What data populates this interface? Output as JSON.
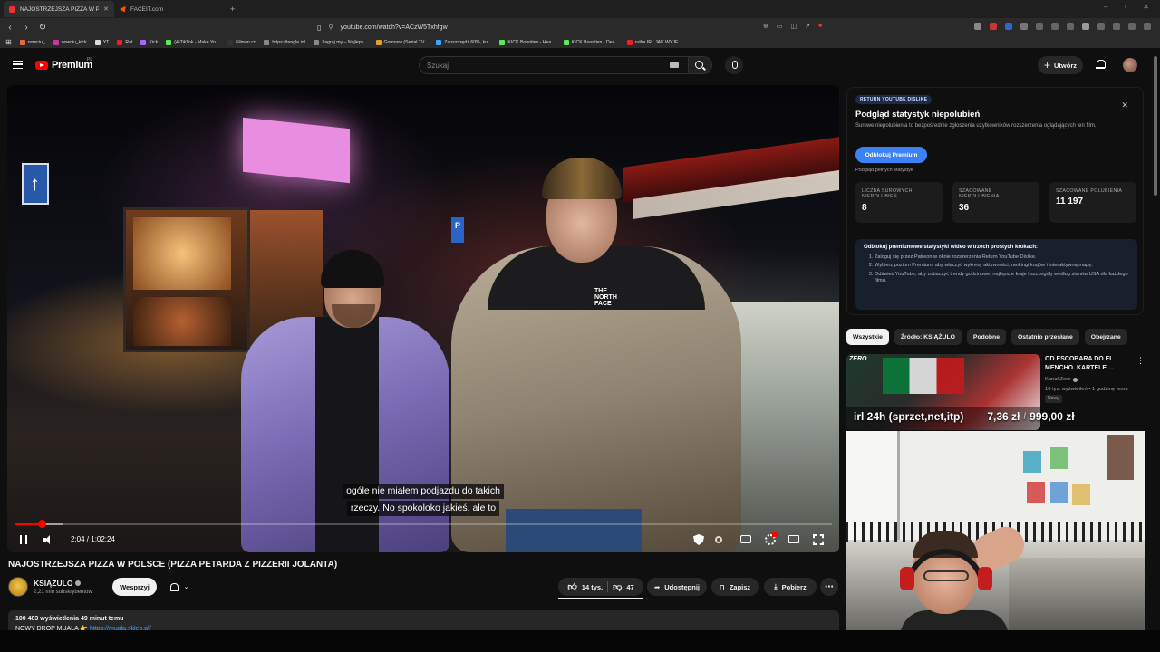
{
  "browser": {
    "tabs": [
      {
        "label": "NAJOSTRZEJSZA PIZZA W PO",
        "active": true
      },
      {
        "label": "FACEIT.com",
        "active": false
      }
    ],
    "url": "youtube.com/watch?v=ACzW5Txhfgw",
    "bookmarks": [
      "nowciu_",
      "nowciu_kick",
      "YT",
      "Rat",
      "Kick",
      "(4)TikTok - Make Yo...",
      "Filman.cc",
      "https://tangle.io/",
      "Zagraj.my – Najleps...",
      "Gomorra (Serial TV...",
      "Zaoszczędź 60%, ku...",
      "KICK Bounties - Hea...",
      "KICK Bounties - Dea...",
      "rutka IRL JAK WYJE..."
    ]
  },
  "header": {
    "logo_text": "Premium",
    "region": "PL",
    "search_placeholder": "Szukaj",
    "create_label": "Utwórz"
  },
  "player": {
    "caption_line1": "ogóle nie miałem podjazdu do takich",
    "caption_line2": "rzeczy. No spokoloko jakieś, ale to",
    "time": "2:04 / 1:02:24",
    "progress": 0.033
  },
  "video": {
    "title": "NAJOSTRZEJSZA PIZZA W POLSCE (PIZZA PETARDA Z PIZZERII JOLANTA)",
    "channel": "KSIĄŻULO",
    "subscribers": "2,21 mln subskrybentów",
    "join_label": "Wesprzyj",
    "likes": "14 tys.",
    "dislikes": "47",
    "share_label": "Udostępnij",
    "save_label": "Zapisz",
    "download_label": "Pobierz",
    "stats": "100 483 wyświetlenia  49 minut temu",
    "desc_prefix": "NOWY DROP MUALA 👉",
    "desc_link": "https://muala.sklep.pl/"
  },
  "dislike_panel": {
    "badge": "RETURN YOUTUBE DISLIKE",
    "title": "Podgląd statystyk niepolubień",
    "description": "Surowe niepolubienia to bezpośrednie zgłoszenia użytkowników rozszerzenia oglądających ten film.",
    "unlock_label": "Odblokuj Premium",
    "small_note": "Podgląd pełnych statystyk",
    "stats": [
      {
        "label": "LICZBA SUROWYCH NIEPOLUBIEŃ",
        "value": "8"
      },
      {
        "label": "SZACOWANE NIEPOLUBIENIA",
        "value": "36"
      },
      {
        "label": "SZACOWANE POLUBIENIA",
        "value": "11 197"
      }
    ],
    "steps_header": "Odblokuj premiumowe statystyki wideo w trzech prostych krokach:",
    "steps": [
      "Zaloguj się przez Patreon w oknie rozszerzenia Return YouTube Dislike.",
      "Wybierz poziom Premium, aby włączyć wykresy aktywności, rankingi krajów i interaktywną mapę.",
      "Odśwież YouTube, aby zobaczyć trendy godzinowe, najlepsze kraje i szczegóły według stanów USA dla każdego filmu."
    ]
  },
  "chips": [
    "Wszystkie",
    "Źródło: KSIĄŻULO",
    "Podobne",
    "Ostatnio przesłane",
    "Obejrzane"
  ],
  "recommendation": {
    "thumb_brand": "ZERO",
    "title": "OD ESCOBARA DO EL MENCHO. KARTELE ...",
    "channel": "Kanał Zero",
    "meta": "16 tys. wyświetleń • 1 godzinę temu",
    "badge": "Nowy"
  },
  "overlay_banner": {
    "text1": "irl 24h (sprzet,net,itp)",
    "text2": "7,36 zł",
    "text3": "/",
    "text4": "999,00 zł"
  }
}
